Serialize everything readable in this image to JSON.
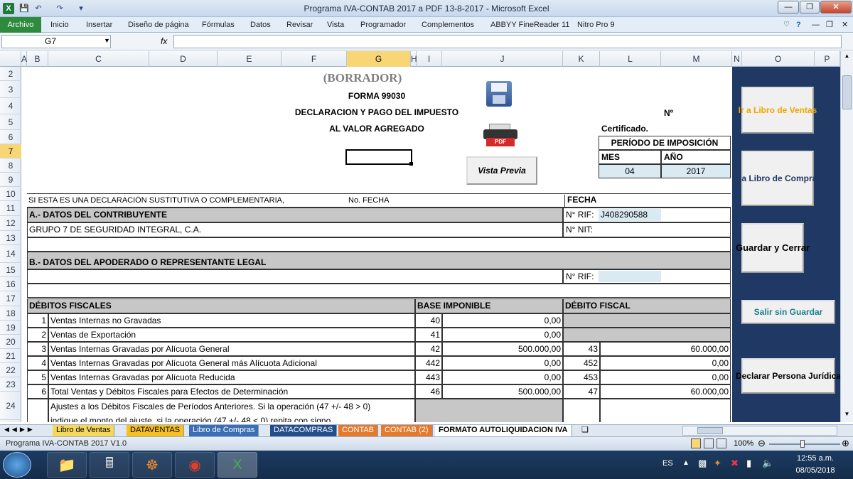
{
  "window": {
    "title": "Programa IVA-CONTAB 2017 a PDF 13-8-2017 - Microsoft Excel"
  },
  "ribbon": {
    "file": "Archivo",
    "tabs": [
      "Inicio",
      "Insertar",
      "Diseño de página",
      "Fórmulas",
      "Datos",
      "Revisar",
      "Vista",
      "Programador",
      "Complementos",
      "ABBYY FineReader 11",
      "Nitro Pro 9"
    ]
  },
  "formula_bar": {
    "name_box": "G7",
    "fx": "fx",
    "value": ""
  },
  "columns": [
    "A",
    "B",
    "C",
    "D",
    "E",
    "F",
    "G",
    "H",
    "I",
    "J",
    "K",
    "L",
    "M",
    "N",
    "O",
    "P"
  ],
  "rows": [
    "2",
    "3",
    "4",
    "5",
    "6",
    "7",
    "8",
    "9",
    "10",
    "11",
    "12",
    "13",
    "14",
    "15",
    "16",
    "17",
    "18",
    "19",
    "20",
    "21",
    "22",
    "23",
    "24"
  ],
  "form": {
    "borrador": "(BORRADOR)",
    "forma": "FORMA 99030",
    "line1": "DECLARACION Y PAGO DEL IMPUESTO",
    "line2": "AL VALOR AGREGADO",
    "pdf_label": "PDF",
    "numero": "Nº",
    "certificado": "Certificado.",
    "periodo": "PERÍODO DE IMPOSICIÓN",
    "mes_label": "MES",
    "anio_label": "AÑO",
    "mes": "04",
    "anio": "2017",
    "vista_previa": "Vista Previa",
    "sustitutiva": "SI ESTA ES UNA DECLARACIÓN SUSTITUTIVA O COMPLEMENTARIA,",
    "no_fecha": "No.  FECHA",
    "fecha": "FECHA",
    "sec_a": "A.- DATOS DEL CONTRIBUYENTE",
    "rif_label": "N° RIF:",
    "rif": "J408290588",
    "contribuyente": "GRUPO 7 DE SEGURIDAD INTEGRAL, C.A.",
    "nit_label": "N° NIT:",
    "sec_b": "B.- DATOS DEL APODERADO O REPRESENTANTE LEGAL",
    "rif2_label": "N° RIF:",
    "debitos": "DÉBITOS FISCALES",
    "base": "BASE IMPONIBLE",
    "debito": "DÉBITO FISCAL",
    "lines": [
      {
        "n": "1",
        "desc": "Ventas Internas no Gravadas",
        "code": "40",
        "base": "0,00",
        "dcode": "",
        "deb": ""
      },
      {
        "n": "2",
        "desc": "Ventas de Exportación",
        "code": "41",
        "base": "0,00",
        "dcode": "",
        "deb": ""
      },
      {
        "n": "3",
        "desc": "Ventas Internas Gravadas por Alícuota General",
        "code": "42",
        "base": "500.000,00",
        "dcode": "43",
        "deb": "60.000,00"
      },
      {
        "n": "4",
        "desc": "Ventas Internas Gravadas por Alícuota General más Alícuota Adicional",
        "code": "442",
        "base": "0,00",
        "dcode": "452",
        "deb": "0,00"
      },
      {
        "n": "5",
        "desc": "Ventas Internas Gravadas por Alícuota Reducida",
        "code": "443",
        "base": "0,00",
        "dcode": "453",
        "deb": "0,00"
      },
      {
        "n": "6",
        "desc": "Total Ventas y Débitos Fiscales para Efectos de Determinación",
        "code": "46",
        "base": "500.000,00",
        "dcode": "47",
        "deb": "60.000,00"
      }
    ],
    "ajustes1": "Ajustes a los Débitos Fiscales de Períodos Anteriores. Si la operación (47 +/- 48 > 0)",
    "ajustes2": "indique el monto del ajuste, si la operación (47 +/- 48 < 0) repita con signo"
  },
  "side_buttons": {
    "libro_ventas": "Ir a Libro de Ventas",
    "libro_compras": "Ir a Libro de Compras",
    "guardar": "Guardar y Cerrar",
    "salir": "Salir sin Guardar",
    "declarar": "Declarar Persona Jurídica"
  },
  "sheet_tabs": [
    "Libro de Ventas",
    "DATAVENTAS",
    "Libro de Compras",
    "DATACOMPRAS",
    "CONTAB",
    "CONTAB (2)",
    "FORMATO AUTOLIQUIDACION IVA"
  ],
  "status": {
    "left": "Programa IVA-CONTAB 2017 V1.0",
    "zoom": "100%"
  },
  "taskbar": {
    "lang": "ES",
    "time": "12:55 a.m.",
    "date": "08/05/2018"
  },
  "colors": {
    "navy": "#1f3864",
    "ventas_btn_text": "#f0a400",
    "compras_btn_text": "#1f3864",
    "salir_btn_text": "#1a7f8f",
    "cell_blue": "#daeaf3",
    "cell_gray": "#c7c7c7"
  }
}
